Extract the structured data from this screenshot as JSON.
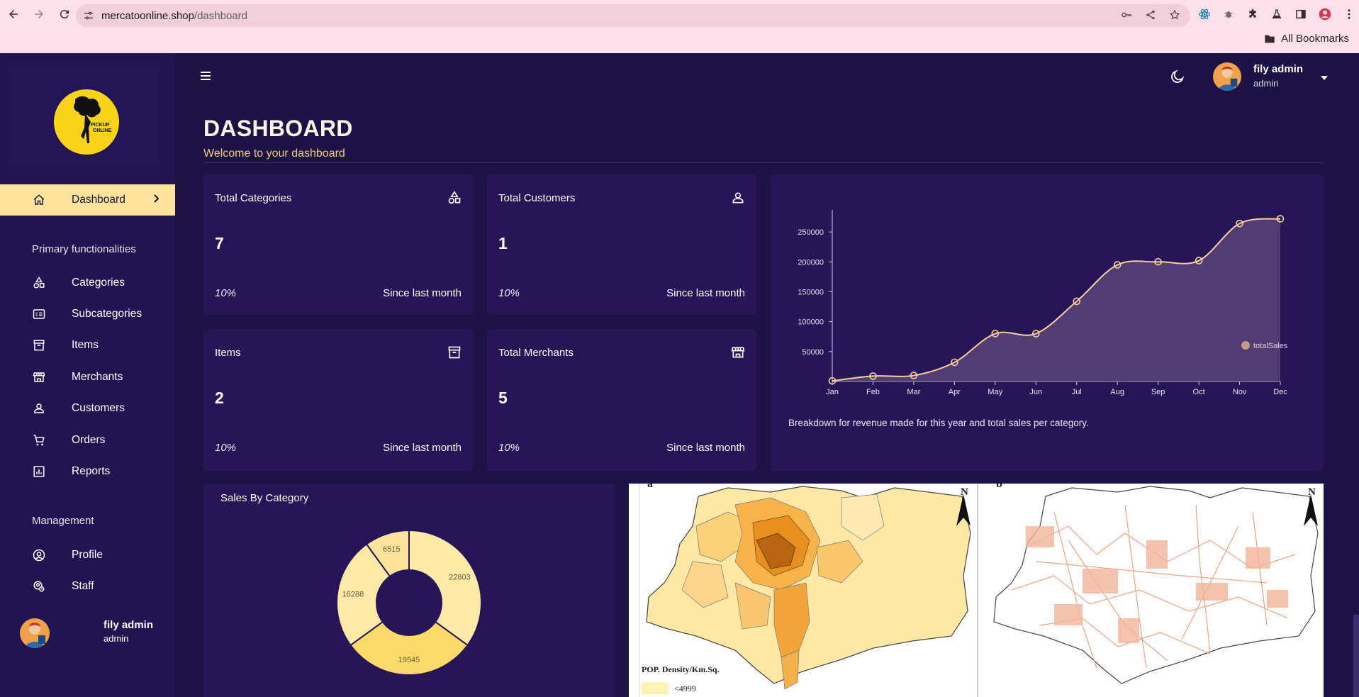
{
  "browser": {
    "url_host": "mercatoonline.shop",
    "url_path": "/dashboard",
    "bookmarks_label": "All Bookmarks"
  },
  "sidebar": {
    "logo_text_1": "PICKUP",
    "logo_text_2": "ONLINE",
    "active_item": {
      "label": "Dashboard",
      "icon": "home-icon"
    },
    "section_primary": "Primary functionalities",
    "primary_items": [
      {
        "label": "Categories",
        "icon": "shapes-icon"
      },
      {
        "label": "Subcategories",
        "icon": "card-list-icon"
      },
      {
        "label": "Items",
        "icon": "archive-icon"
      },
      {
        "label": "Merchants",
        "icon": "store-icon"
      },
      {
        "label": "Customers",
        "icon": "person-icon"
      },
      {
        "label": "Orders",
        "icon": "cart-icon"
      },
      {
        "label": "Reports",
        "icon": "bar-chart-icon"
      }
    ],
    "section_management": "Management",
    "management_items": [
      {
        "label": "Profile",
        "icon": "account-circle-icon"
      },
      {
        "label": "Staff",
        "icon": "staff-icon"
      }
    ],
    "user": {
      "name": "fily admin",
      "role": "admin"
    }
  },
  "header": {
    "user": {
      "name": "fily admin",
      "role": "admin"
    }
  },
  "page": {
    "title": "DASHBOARD",
    "subtitle": "Welcome to your dashboard"
  },
  "stats": [
    {
      "title": "Total Categories",
      "value": "7",
      "pct": "10%",
      "since": "Since last month",
      "icon": "shapes-icon"
    },
    {
      "title": "Total Customers",
      "value": "1",
      "pct": "10%",
      "since": "Since last month",
      "icon": "person-icon"
    },
    {
      "title": "Items",
      "value": "2",
      "pct": "10%",
      "since": "Since last month",
      "icon": "archive-icon"
    },
    {
      "title": "Total Merchants",
      "value": "5",
      "pct": "10%",
      "since": "Since last month",
      "icon": "store-icon"
    }
  ],
  "sales_chart": {
    "caption": "Breakdown for revenue made for this year and total sales per category."
  },
  "category_chart": {
    "title": "Sales By Category"
  },
  "map_figure": {
    "panel_a": "a",
    "panel_b": "b",
    "north_a": "N",
    "north_b": "N",
    "legend_title": "POP. Density/Km.Sq.",
    "legend_first": "<4999"
  },
  "colors": {
    "background": "#1c1245",
    "card": "#261657",
    "sidebar": "#221452",
    "accent": "#fde39b",
    "line": "#f7cfa0"
  },
  "chart_data": [
    {
      "type": "area",
      "categories": [
        "Jan",
        "Feb",
        "Mar",
        "Apr",
        "May",
        "Jun",
        "Jul",
        "Aug",
        "Sep",
        "Oct",
        "Nov",
        "Dec"
      ],
      "series": [
        {
          "name": "totalSales",
          "values": [
            1000,
            9000,
            10000,
            32000,
            80000,
            80000,
            134000,
            195000,
            200000,
            202000,
            264000,
            272000
          ]
        }
      ],
      "yticks": [
        50000,
        100000,
        150000,
        200000,
        250000
      ],
      "ylim": [
        0,
        275000
      ],
      "legend": "right"
    },
    {
      "type": "pie",
      "donut": true,
      "values": [
        22803,
        19545,
        16288,
        6515
      ],
      "colors": [
        "#fee9a6",
        "#fdd96a",
        "#fee9a6",
        "#fee39a"
      ]
    }
  ]
}
